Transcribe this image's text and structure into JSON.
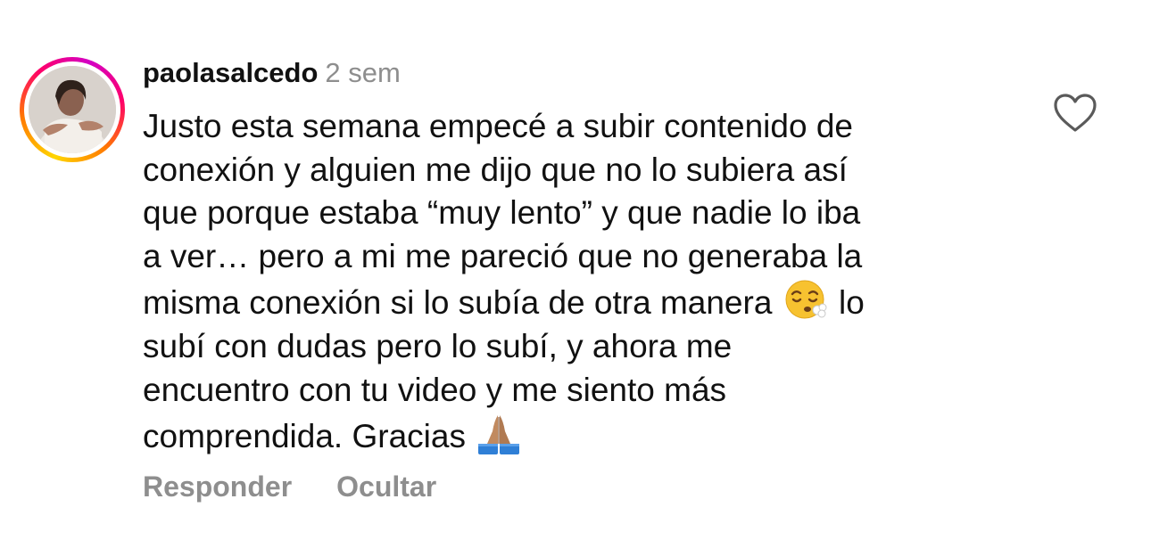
{
  "comment": {
    "username": "paolasalcedo",
    "time": "2 sem",
    "avatar_icon": "profile-photo",
    "lines": [
      "Justo esta semana empecé a subir contenido de",
      "conexión y alguien me dijo que no lo subiera así",
      "que porque estaba “muy lento” y que nadie lo iba",
      "a ver… pero a mi me pareció que no generaba la",
      "misma conexión si lo subía de otra manera",
      "lo",
      "subí con dudas pero lo subí, y ahora me",
      "encuentro con tu video y me siento más",
      "comprendida. Gracias"
    ],
    "emojis": [
      "face-exhaling-emoji",
      "folded-hands-emoji"
    ],
    "reply_label": "Responder",
    "hide_label": "Ocultar",
    "like_icon": "heart-outline-icon"
  },
  "colors": {
    "text": "#111111",
    "secondary": "#8e8e8e",
    "ring_gradient": [
      "#ffd600",
      "#ff7a00",
      "#ff0169",
      "#d300c5"
    ]
  }
}
